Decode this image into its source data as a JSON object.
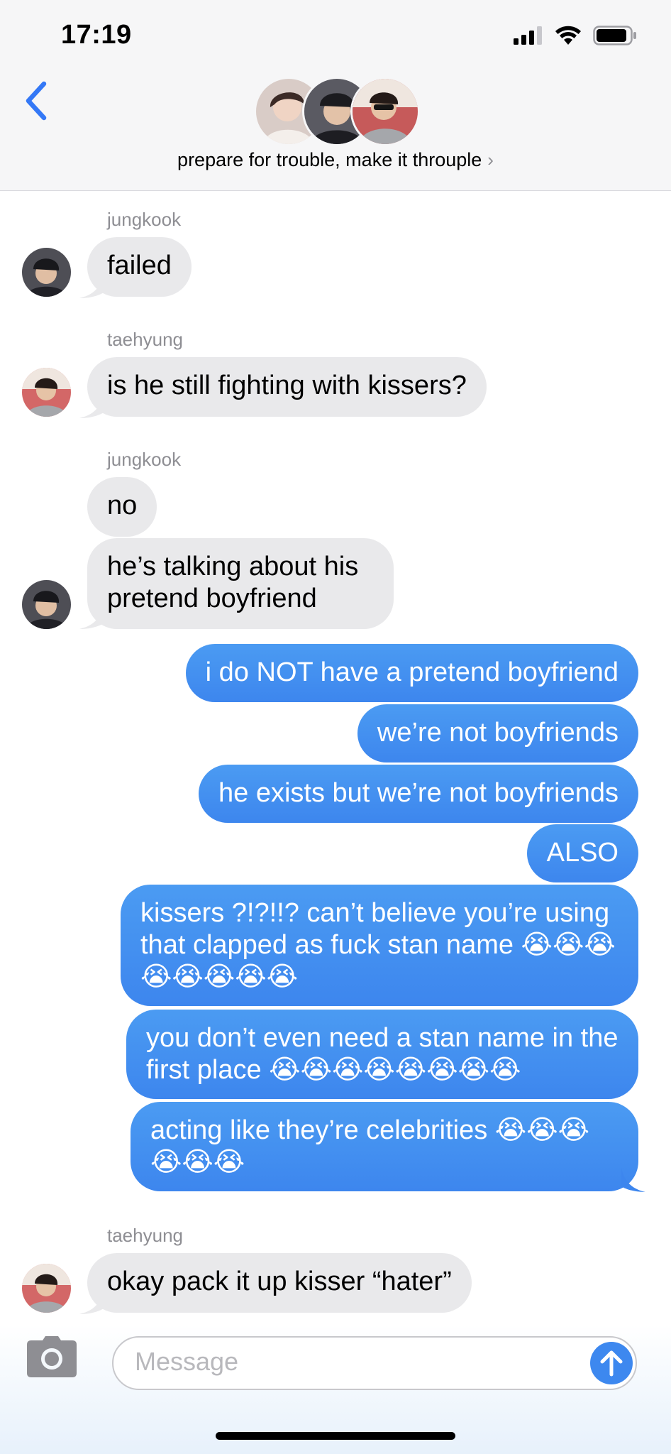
{
  "status_bar": {
    "time": "17:19"
  },
  "header": {
    "title": "prepare for trouble, make it throuple",
    "chevron": "›"
  },
  "messages": [
    {
      "sender": "jungkook",
      "text": "failed"
    },
    {
      "sender": "taehyung",
      "text": "is he still fighting with kissers?"
    },
    {
      "sender": "jungkook",
      "text": "no"
    },
    {
      "text": "he’s talking about his pretend boyfriend"
    },
    {
      "text": "i do NOT have a pretend boyfriend"
    },
    {
      "text": "we’re not boyfriends"
    },
    {
      "text": "he exists but we’re not boyfriends"
    },
    {
      "text": "ALSO"
    },
    {
      "text": "kissers ?!?!!? can’t believe you’re using that clapped as fuck stan name 😭😭😭😭😭😭😭😭"
    },
    {
      "text": "you don’t even need a stan name in the first place 😭😭😭😭😭😭😭😭"
    },
    {
      "text": "acting like they’re celebrities 😭😭😭😭😭😭"
    },
    {
      "sender": "taehyung",
      "text": "okay pack it up kisser “hater”"
    }
  ],
  "composer": {
    "placeholder": "Message"
  },
  "colors": {
    "outgoing": "#3d88ef",
    "incoming": "#e9e9eb",
    "accent": "#3478f6"
  },
  "icons": [
    "back-chevron-icon",
    "camera-icon",
    "send-arrow-icon",
    "signal-icon",
    "wifi-icon",
    "battery-icon"
  ]
}
